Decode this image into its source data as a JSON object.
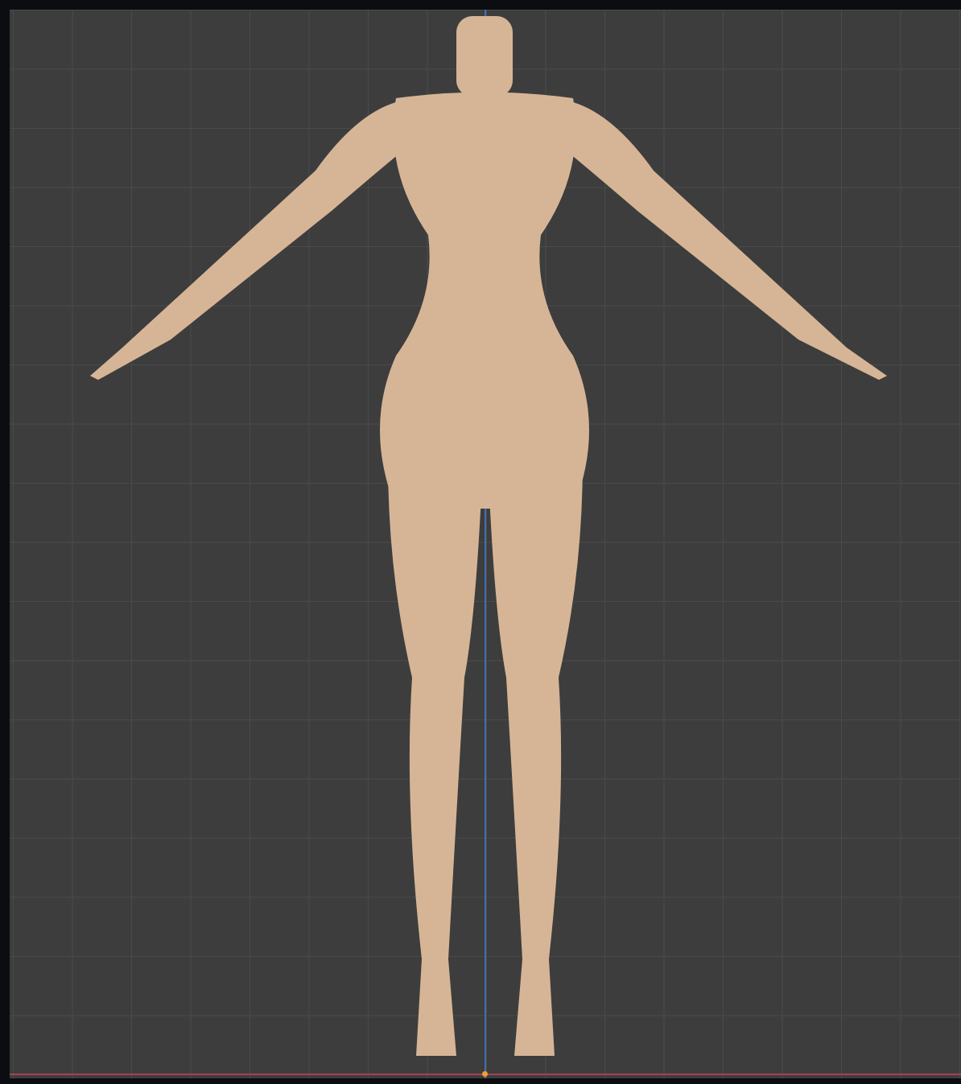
{
  "viewport": {
    "background_color": "#3d3d3d",
    "grid_color": "#4a4a4a",
    "x_axis_color": "#a8414f",
    "z_axis_color": "#3f6fb5",
    "origin_color": "#f0a030",
    "model_color": "#d6b596",
    "model_icon": "mannequin-model"
  }
}
